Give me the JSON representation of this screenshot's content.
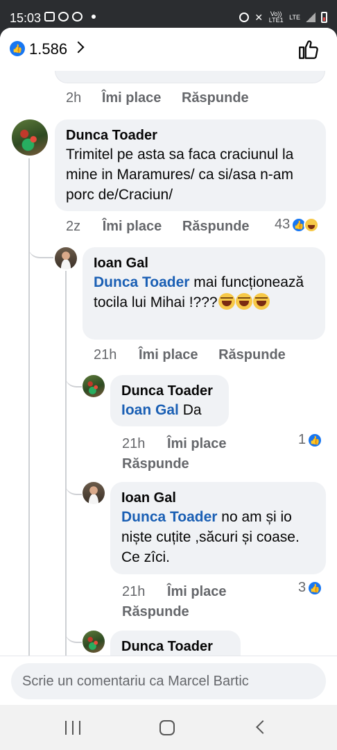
{
  "status_bar": {
    "time": "15:03",
    "network": "LTE",
    "carrier_tag": "Vo)) LTE1"
  },
  "header": {
    "like_count": "1.586"
  },
  "previous_comment_meta": {
    "time": "2h",
    "like": "Îmi place",
    "reply": "Răspunde"
  },
  "comments": [
    {
      "author": "Dunca Toader",
      "text": "Trimitel pe asta sa faca craciunul la mine in Maramures/ ca si/asa n-am porc de/Craciun/",
      "time": "2z",
      "like": "Îmi place",
      "reply": "Răspunde",
      "reactions": "43"
    },
    {
      "author": "Ioan Gal",
      "mention": "Dunca Toader",
      "text": " mai funcționează tocila lui Mihai !???",
      "time": "21h",
      "like": "Îmi place",
      "reply": "Răspunde"
    },
    {
      "author": "Dunca Toader",
      "mention": "Ioan Gal",
      "text": " Da",
      "time": "21h",
      "like": "Îmi place",
      "reply": "Răspunde",
      "reactions": "1"
    },
    {
      "author": "Ioan Gal",
      "mention": "Dunca Toader",
      "text": " no am și io niște cuțite ,săcuri și coase. Ce zîci.",
      "time": "21h",
      "like": "Îmi place",
      "reply": "Răspunde",
      "reactions": "3"
    },
    {
      "author": "Dunca Toader"
    }
  ],
  "composer": {
    "placeholder": "Scrie un comentariu ca Marcel Bartic"
  },
  "colors": {
    "accent": "#1877f2",
    "mention": "#1a5fb4",
    "bubble": "#f0f2f5",
    "meta": "#65676b"
  }
}
